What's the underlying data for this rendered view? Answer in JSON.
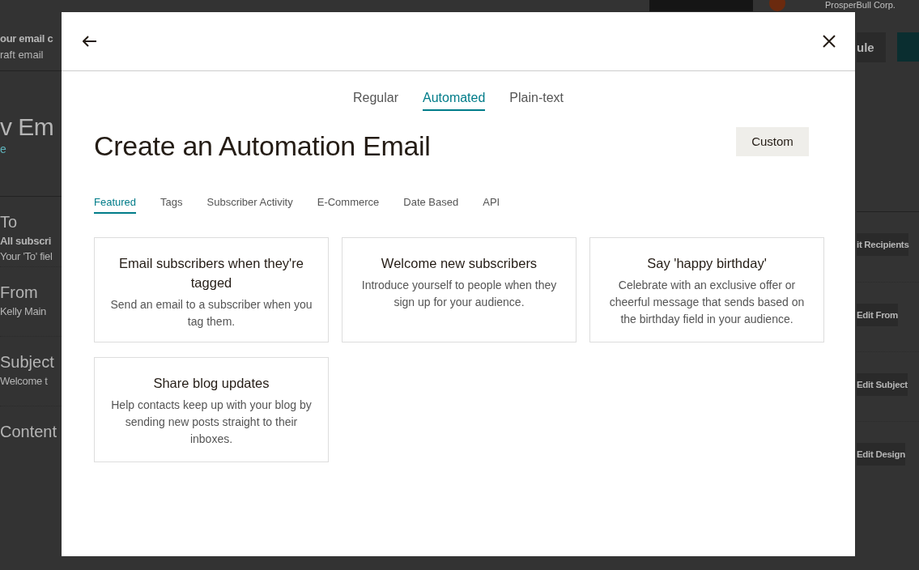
{
  "background": {
    "account": "ProsperBull Corp.",
    "header_title": "our email c",
    "header_subtitle": "raft email",
    "schedule_button": "ule",
    "page_heading": "v Em",
    "page_link": "e",
    "sections": [
      {
        "label": "To",
        "value": "All subscri",
        "note": "Your 'To' fiel",
        "action": "it Recipients"
      },
      {
        "label": "From",
        "value": "Kelly Main",
        "action": "Edit From"
      },
      {
        "label": "Subject",
        "value": "Welcome t",
        "action": "Edit Subject"
      },
      {
        "label": "Content",
        "action": "Edit Design"
      }
    ]
  },
  "modal": {
    "type_tabs": [
      {
        "label": "Regular",
        "selected": false
      },
      {
        "label": "Automated",
        "selected": true
      },
      {
        "label": "Plain-text",
        "selected": false
      }
    ],
    "title": "Create an Automation Email",
    "custom_button": "Custom",
    "category_tabs": [
      {
        "label": "Featured",
        "selected": true
      },
      {
        "label": "Tags",
        "selected": false
      },
      {
        "label": "Subscriber Activity",
        "selected": false
      },
      {
        "label": "E-Commerce",
        "selected": false
      },
      {
        "label": "Date Based",
        "selected": false
      },
      {
        "label": "API",
        "selected": false
      }
    ],
    "cards": [
      {
        "title": "Email subscribers when they're tagged",
        "description": "Send an email to a subscriber when you tag them."
      },
      {
        "title": "Welcome new subscribers",
        "description": "Introduce yourself to people when they sign up for your audience."
      },
      {
        "title": "Say 'happy birthday'",
        "description": "Celebrate with an exclusive offer or cheerful message that sends based on the birthday field in your audience."
      },
      {
        "title": "Share blog updates",
        "description": "Help contacts keep up with your blog by sending new posts straight to their inboxes."
      }
    ]
  }
}
